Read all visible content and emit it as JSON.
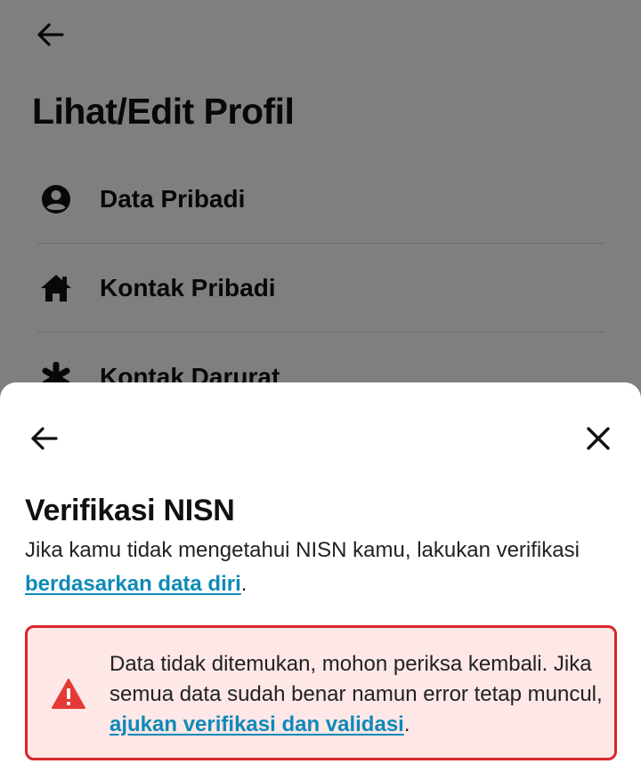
{
  "background_page": {
    "title": "Lihat/Edit Profil",
    "menu": [
      {
        "label": "Data Pribadi",
        "icon": "account-circle-icon"
      },
      {
        "label": "Kontak Pribadi",
        "icon": "home-icon"
      },
      {
        "label": "Kontak Darurat",
        "icon": "asterisk-icon"
      }
    ]
  },
  "sheet": {
    "back_icon": "arrow-left-icon",
    "close_icon": "close-icon",
    "title": "Verifikasi NISN",
    "description": {
      "text": "Jika kamu tidak mengetahui NISN kamu, lakukan verifikasi ",
      "link": "berdasarkan data diri",
      "suffix": "."
    },
    "alert": {
      "icon": "warning-triangle-icon",
      "text": "Data tidak ditemukan, mohon periksa kembali. Jika semua data sudah benar namun error tetap muncul, ",
      "link": "ajukan verifikasi dan validasi",
      "suffix": "."
    }
  },
  "colors": {
    "link": "#0f8ab8",
    "alert_border": "#d9262c",
    "alert_background": "#fde7e7",
    "alert_icon": "#e53935",
    "overlay": "rgba(0,0,0,0.5)"
  }
}
